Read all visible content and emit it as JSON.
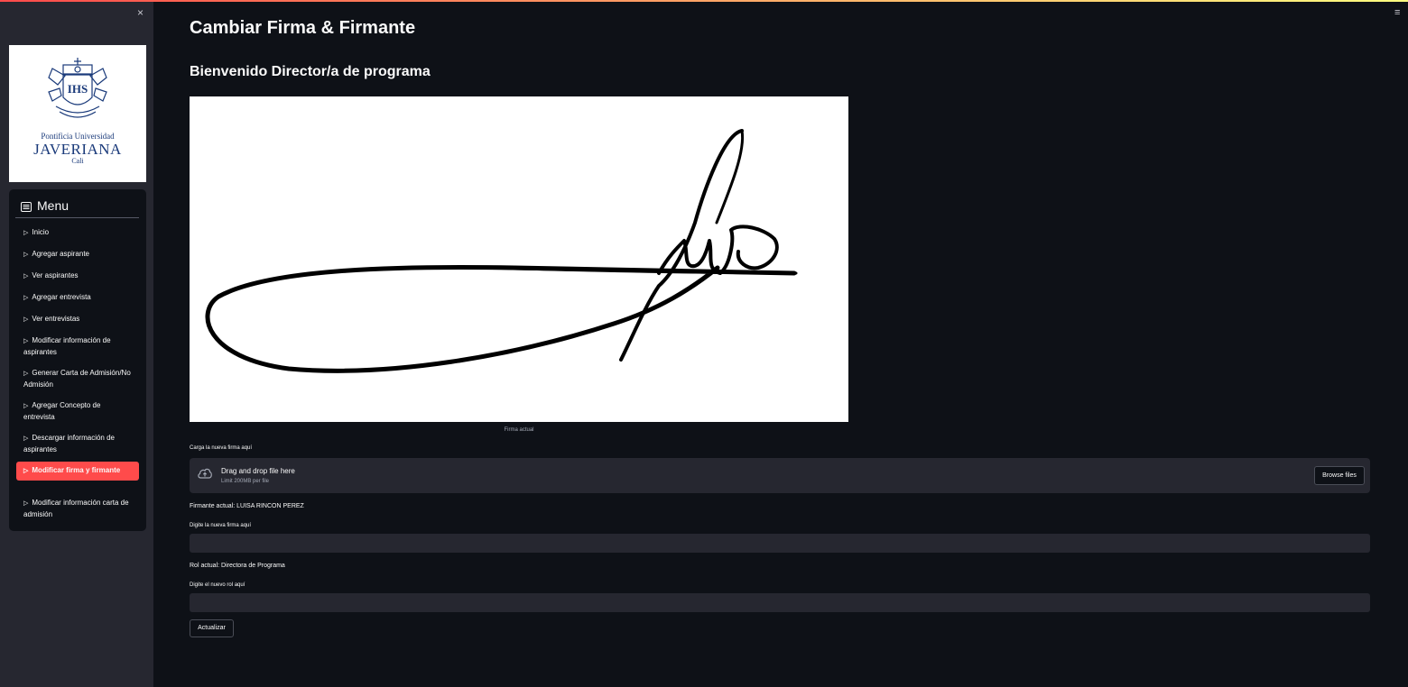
{
  "sidebar": {
    "close_label": "×",
    "logo": {
      "line1": "Pontificia Universidad",
      "line2": "JAVERIANA",
      "line3": "Cali",
      "seal_text": "IHS"
    },
    "menu_title": "Menu",
    "items": [
      {
        "label": "Inicio"
      },
      {
        "label": "Agregar aspirante"
      },
      {
        "label": "Ver aspirantes"
      },
      {
        "label": "Agregar entrevista"
      },
      {
        "label": "Ver entrevistas"
      },
      {
        "label": "Modificar información de aspirantes"
      },
      {
        "label": "Generar Carta de Admisión/No Admisión"
      },
      {
        "label": "Agregar Concepto de entrevista"
      },
      {
        "label": "Descargar información de aspirantes"
      },
      {
        "label": "Modificar firma y firmante",
        "active": true
      },
      {
        "label": "Modificar información carta de admisión"
      }
    ]
  },
  "header": {
    "menu_icon": "≡"
  },
  "main": {
    "title": "Cambiar Firma & Firmante",
    "welcome": "Bienvenido Director/a de programa",
    "signature_caption": "Firma actual",
    "upload_label": "Carga la nueva firma aquí",
    "uploader": {
      "main_text": "Drag and drop file here",
      "sub_text": "Limit 200MB per file",
      "browse_label": "Browse files",
      "icon": "cloud-upload-icon"
    },
    "current_signer": "Firmante actual: LUISA RINCON PEREZ",
    "new_signer_label": "Digite la nueva firma aquí",
    "new_signer_value": "",
    "current_role": "Rol actual: Directora de Programa",
    "new_role_label": "Digite el nuevo rol aquí",
    "new_role_value": "",
    "update_button": "Actualizar"
  },
  "colors": {
    "background": "#0e1117",
    "sidebar": "#262730",
    "accent": "#ff4b4b",
    "logo_blue": "#1a3a7a"
  }
}
